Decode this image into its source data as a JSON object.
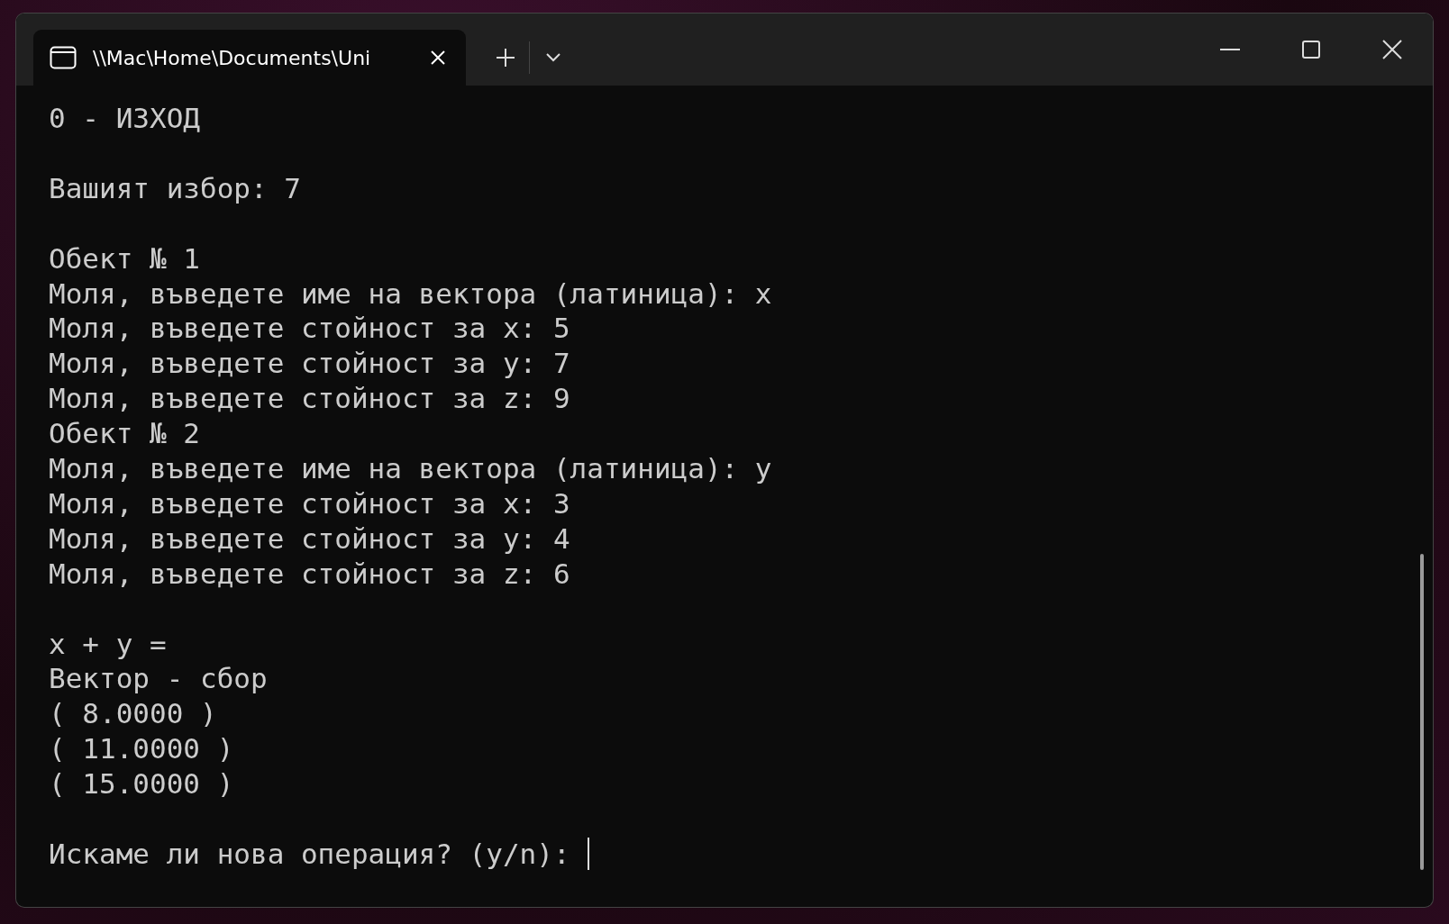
{
  "window": {
    "tabs": [
      {
        "title": "\\\\Mac\\Home\\Documents\\Uni",
        "selected": true
      }
    ]
  },
  "terminal": {
    "blocks": [
      [
        "0 - ИЗХОД"
      ],
      [
        "Вашият избор: 7"
      ],
      [
        "Обект № 1",
        "Моля, въведете име на вектора (латиница): x",
        "Моля, въведете стойност за x: 5",
        "Моля, въведете стойност за y: 7",
        "Моля, въведете стойност за z: 9",
        "Обект № 2",
        "Моля, въведете име на вектора (латиница): y",
        "Моля, въведете стойност за x: 3",
        "Моля, въведете стойност за y: 4",
        "Моля, въведете стойност за z: 6"
      ],
      [
        "x + y =",
        "Вектор - сбор",
        "( 8.0000 )",
        "( 11.0000 )",
        "( 15.0000 )"
      ]
    ],
    "prompt": {
      "text": "Искаме ли нова операция? (y/n):",
      "cursor": true
    }
  }
}
